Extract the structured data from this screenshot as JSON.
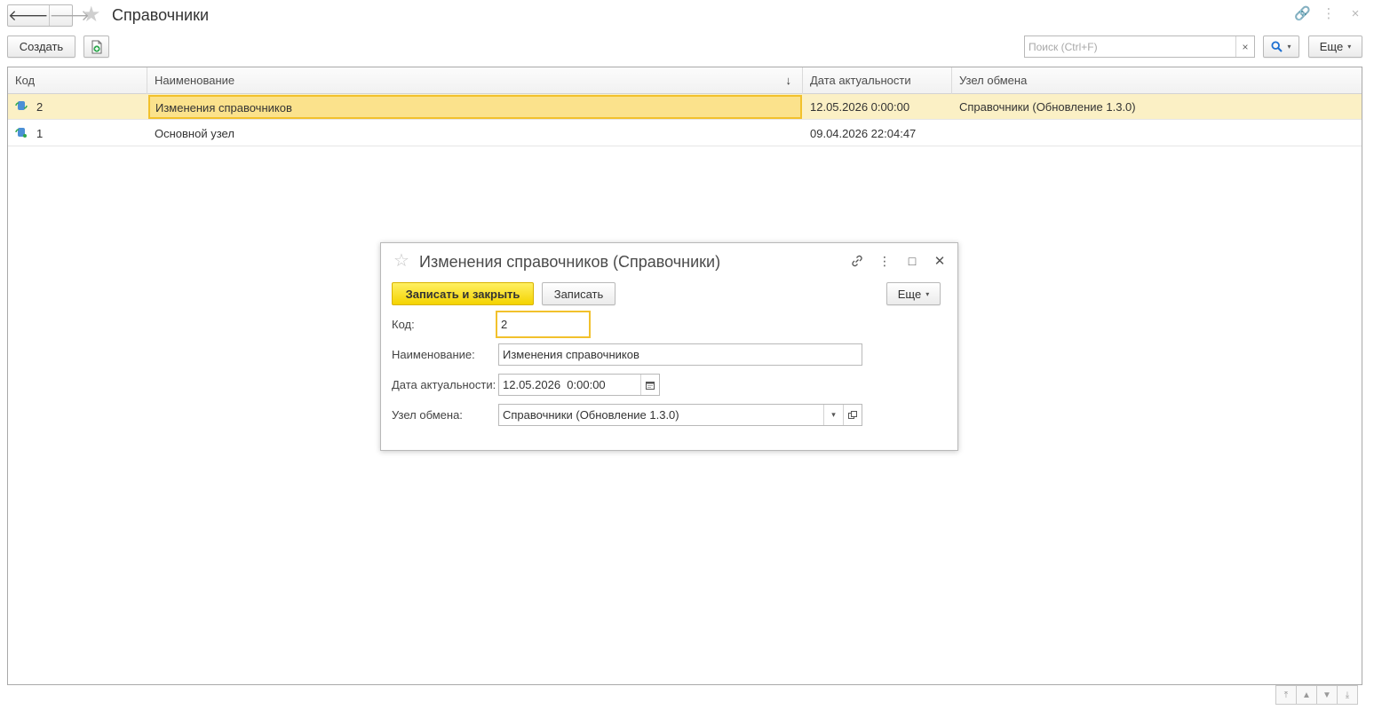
{
  "window": {
    "title": "Справочники",
    "back_glyph": "🡐",
    "forward_glyph": "🡒",
    "star_glyph": "★",
    "link_glyph": "🔗",
    "menu_glyph": "⋮",
    "close_glyph": "×"
  },
  "toolbar": {
    "create_label": "Создать",
    "search_placeholder": "Поиск (Ctrl+F)",
    "search_clear_glyph": "×",
    "search_glyph": "🔍",
    "more_label": "Еще",
    "caret_glyph": "▾"
  },
  "table": {
    "columns": [
      {
        "label": "Код"
      },
      {
        "label": "Наименование",
        "sort": "↓"
      },
      {
        "label": "Дата актуальности"
      },
      {
        "label": "Узел обмена"
      }
    ],
    "rows": [
      {
        "code": "2",
        "name": "Изменения справочников",
        "date": "12.05.2026 0:00:00",
        "node": "Справочники (Обновление 1.3.0)",
        "selected": true
      },
      {
        "code": "1",
        "name": "Основной узел",
        "date": "09.04.2026 22:04:47",
        "node": "",
        "selected": false
      }
    ]
  },
  "scroll": {
    "first_glyph": "⤒",
    "up_glyph": "▲",
    "down_glyph": "▼",
    "last_glyph": "⤓"
  },
  "dialog": {
    "title": "Изменения справочников (Справочники)",
    "star_glyph": "☆",
    "maximize_glyph": "□",
    "close_glyph": "✕",
    "save_close_label": "Записать и закрыть",
    "save_label": "Записать",
    "more_label": "Еще",
    "fields": {
      "code": {
        "label": "Код:",
        "value": "2"
      },
      "name": {
        "label": "Наименование:",
        "value": "Изменения справочников"
      },
      "date": {
        "label": "Дата актуальности:",
        "value": "12.05.2026  0:00:00"
      },
      "node": {
        "label": "Узел обмена:",
        "value": "Справочники (Обновление 1.3.0)"
      }
    }
  },
  "colors": {
    "accent_yellow": "#f4d300",
    "selected_row": "#fbf0c5",
    "active_cell": "#fbe28c",
    "focus_border": "#f2c12c"
  }
}
